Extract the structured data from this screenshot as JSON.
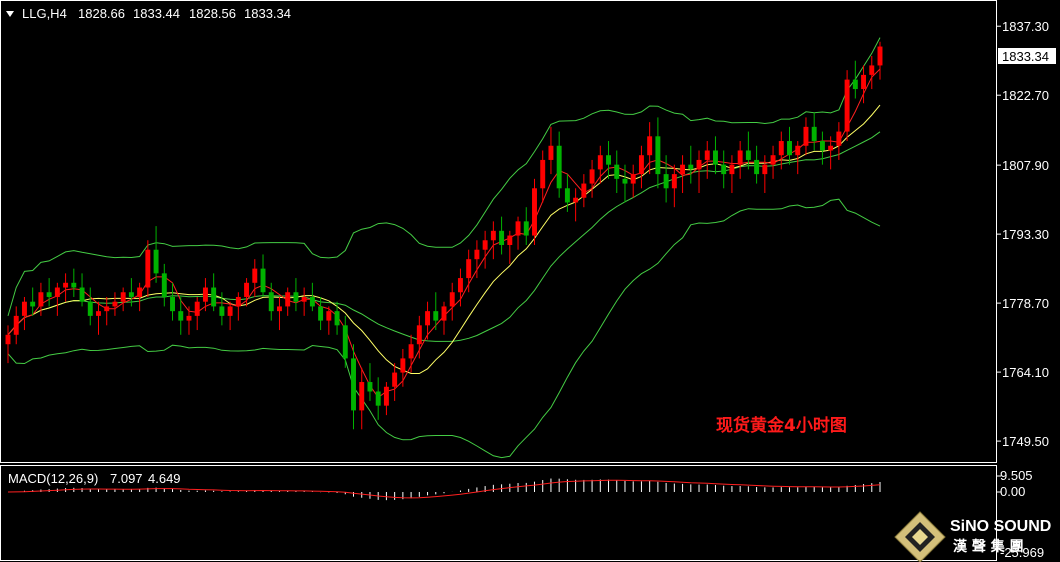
{
  "header": {
    "symbol": "LLG,H4",
    "open": "1828.66",
    "high": "1833.44",
    "low": "1828.56",
    "close": "1833.34"
  },
  "annotation": "现货黄金4小时图",
  "macd": {
    "label": "MACD(12,26,9)",
    "main": "7.097",
    "signal": "4.649",
    "ticks": [
      "9.505",
      "0.00",
      "-25.969"
    ]
  },
  "logo": {
    "brand": "SiNO SOUND",
    "sub": "漢 聲 集 團"
  },
  "colors": {
    "background": "#000000",
    "bull": "#00b300",
    "bear": "#ff0000",
    "bands": "#44cc44",
    "fast_ma": "#ffff66",
    "slow_ma": "#ff2020",
    "grid": "#ffffff"
  },
  "chart_data": {
    "type": "candlestick",
    "title": "",
    "y_ticks": [
      "1837.30",
      "1822.70",
      "1807.90",
      "1793.30",
      "1778.70",
      "1764.10",
      "1749.50"
    ],
    "y_range": [
      1745.5,
      1842.0
    ],
    "last_price_label": "1833.34",
    "candles": [
      [
        1770,
        1774,
        1766,
        1772
      ],
      [
        1772,
        1778,
        1770,
        1776
      ],
      [
        1776,
        1780,
        1773,
        1779
      ],
      [
        1779,
        1782,
        1776,
        1778
      ],
      [
        1778,
        1783,
        1776,
        1781
      ],
      [
        1781,
        1784,
        1778,
        1780
      ],
      [
        1780,
        1783,
        1776,
        1782
      ],
      [
        1782,
        1785,
        1779,
        1783
      ],
      [
        1783,
        1786,
        1780,
        1782
      ],
      [
        1782,
        1785,
        1778,
        1779
      ],
      [
        1779,
        1782,
        1774,
        1776
      ],
      [
        1776,
        1779,
        1772,
        1777
      ],
      [
        1777,
        1780,
        1774,
        1778
      ],
      [
        1778,
        1781,
        1776,
        1779
      ],
      [
        1779,
        1782,
        1777,
        1781
      ],
      [
        1781,
        1784,
        1778,
        1780
      ],
      [
        1780,
        1783,
        1777,
        1782
      ],
      [
        1782,
        1792,
        1780,
        1790
      ],
      [
        1790,
        1795,
        1783,
        1785
      ],
      [
        1785,
        1787,
        1778,
        1780
      ],
      [
        1780,
        1783,
        1775,
        1777
      ],
      [
        1777,
        1780,
        1772,
        1775
      ],
      [
        1775,
        1778,
        1772,
        1776
      ],
      [
        1776,
        1780,
        1773,
        1779
      ],
      [
        1779,
        1784,
        1777,
        1782
      ],
      [
        1782,
        1785,
        1777,
        1778
      ],
      [
        1778,
        1781,
        1774,
        1776
      ],
      [
        1776,
        1779,
        1773,
        1778
      ],
      [
        1778,
        1781,
        1775,
        1780
      ],
      [
        1780,
        1784,
        1778,
        1783
      ],
      [
        1783,
        1788,
        1780,
        1786
      ],
      [
        1786,
        1789,
        1780,
        1781
      ],
      [
        1781,
        1783,
        1775,
        1777
      ],
      [
        1777,
        1780,
        1773,
        1778
      ],
      [
        1778,
        1782,
        1776,
        1781
      ],
      [
        1781,
        1784,
        1777,
        1779
      ],
      [
        1779,
        1782,
        1776,
        1780
      ],
      [
        1780,
        1783,
        1777,
        1778
      ],
      [
        1778,
        1780,
        1773,
        1775
      ],
      [
        1775,
        1778,
        1772,
        1777
      ],
      [
        1777,
        1779,
        1772,
        1774
      ],
      [
        1774,
        1776,
        1765,
        1767
      ],
      [
        1767,
        1770,
        1752,
        1756
      ],
      [
        1756,
        1765,
        1752,
        1762
      ],
      [
        1762,
        1766,
        1758,
        1760
      ],
      [
        1760,
        1763,
        1754,
        1757
      ],
      [
        1757,
        1762,
        1755,
        1761
      ],
      [
        1761,
        1766,
        1758,
        1764
      ],
      [
        1764,
        1769,
        1761,
        1767
      ],
      [
        1767,
        1772,
        1764,
        1770
      ],
      [
        1770,
        1776,
        1767,
        1774
      ],
      [
        1774,
        1779,
        1771,
        1777
      ],
      [
        1777,
        1781,
        1773,
        1775
      ],
      [
        1775,
        1779,
        1772,
        1778
      ],
      [
        1778,
        1783,
        1775,
        1781
      ],
      [
        1781,
        1786,
        1778,
        1784
      ],
      [
        1784,
        1790,
        1781,
        1788
      ],
      [
        1788,
        1792,
        1784,
        1790
      ],
      [
        1790,
        1794,
        1786,
        1792
      ],
      [
        1792,
        1796,
        1788,
        1794
      ],
      [
        1794,
        1797,
        1789,
        1791
      ],
      [
        1791,
        1794,
        1787,
        1793
      ],
      [
        1793,
        1797,
        1790,
        1796
      ],
      [
        1796,
        1799,
        1791,
        1793
      ],
      [
        1793,
        1805,
        1791,
        1803
      ],
      [
        1803,
        1811,
        1800,
        1809
      ],
      [
        1809,
        1816,
        1806,
        1812
      ],
      [
        1812,
        1815,
        1801,
        1803
      ],
      [
        1803,
        1806,
        1798,
        1800
      ],
      [
        1800,
        1803,
        1796,
        1801
      ],
      [
        1801,
        1806,
        1799,
        1804
      ],
      [
        1804,
        1809,
        1801,
        1807
      ],
      [
        1807,
        1812,
        1804,
        1810
      ],
      [
        1810,
        1813,
        1805,
        1808
      ],
      [
        1808,
        1811,
        1802,
        1805
      ],
      [
        1805,
        1808,
        1800,
        1804
      ],
      [
        1804,
        1808,
        1801,
        1806
      ],
      [
        1806,
        1812,
        1803,
        1810
      ],
      [
        1810,
        1817,
        1806,
        1814
      ],
      [
        1814,
        1818,
        1803,
        1806
      ],
      [
        1806,
        1810,
        1800,
        1803
      ],
      [
        1803,
        1808,
        1799,
        1806
      ],
      [
        1806,
        1810,
        1802,
        1808
      ],
      [
        1808,
        1812,
        1804,
        1807
      ],
      [
        1807,
        1811,
        1802,
        1809
      ],
      [
        1809,
        1813,
        1805,
        1811
      ],
      [
        1811,
        1814,
        1806,
        1808
      ],
      [
        1808,
        1811,
        1803,
        1806
      ],
      [
        1806,
        1810,
        1802,
        1808
      ],
      [
        1808,
        1813,
        1805,
        1811
      ],
      [
        1811,
        1815,
        1807,
        1809
      ],
      [
        1809,
        1812,
        1804,
        1806
      ],
      [
        1806,
        1810,
        1802,
        1808
      ],
      [
        1808,
        1812,
        1805,
        1810
      ],
      [
        1810,
        1815,
        1807,
        1813
      ],
      [
        1813,
        1816,
        1808,
        1810
      ],
      [
        1810,
        1813,
        1806,
        1812
      ],
      [
        1812,
        1818,
        1810,
        1816
      ],
      [
        1816,
        1819,
        1811,
        1813
      ],
      [
        1813,
        1815,
        1808,
        1811
      ],
      [
        1811,
        1814,
        1807,
        1812
      ],
      [
        1812,
        1817,
        1809,
        1815
      ],
      [
        1815,
        1828,
        1813,
        1826
      ],
      [
        1826,
        1830,
        1822,
        1824
      ],
      [
        1824,
        1829,
        1821,
        1827
      ],
      [
        1827,
        1831,
        1824,
        1829
      ],
      [
        1829,
        1834,
        1826,
        1833
      ]
    ]
  }
}
